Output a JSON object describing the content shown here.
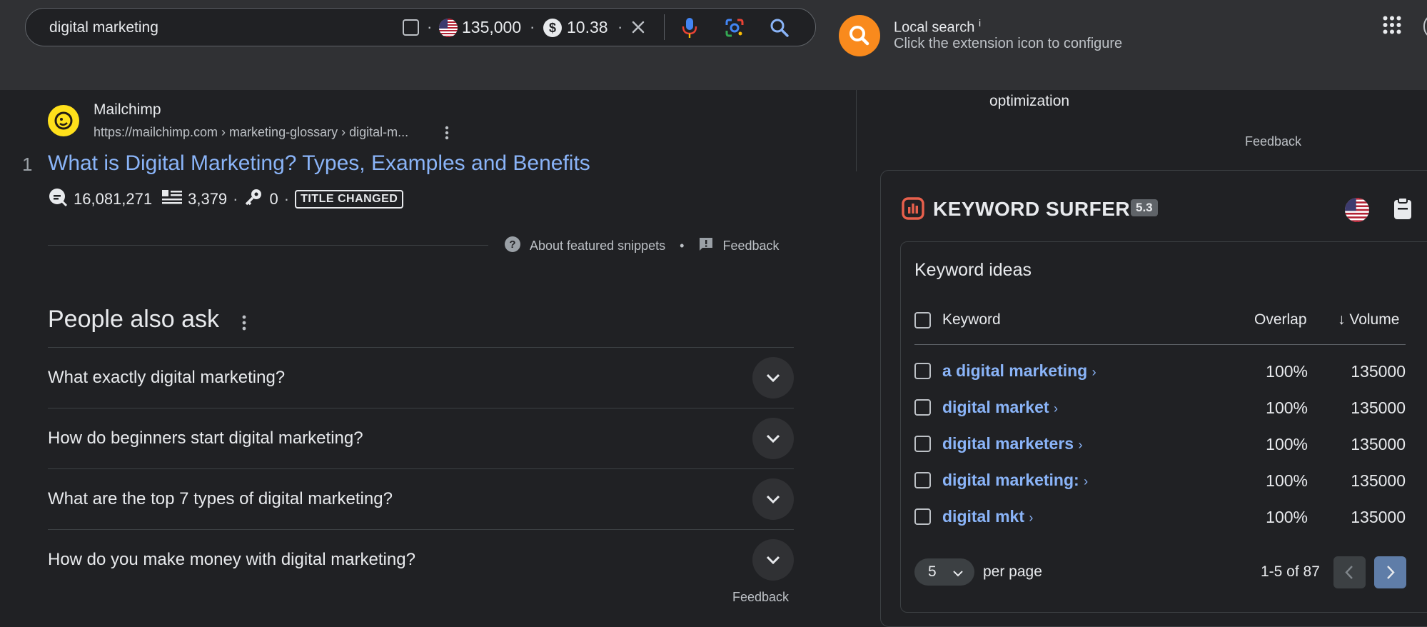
{
  "search": {
    "query": "digital marketing",
    "volume": "135,000",
    "cpc": "10.38"
  },
  "extension": {
    "title": "Local search",
    "info": "i",
    "subtitle": "Click the extension icon to configure"
  },
  "result": {
    "site_name": "Mailchimp",
    "url": "https://mailchimp.com › marketing-glossary › digital-m...",
    "rank": "1",
    "title": "What is Digital Marketing? Types, Examples and Benefits",
    "traffic": "16,081,271",
    "words": "3,379",
    "keywords": "0",
    "badge": "TITLE CHANGED"
  },
  "snippet_footer": {
    "about": "About featured snippets",
    "separator": "•",
    "feedback": "Feedback"
  },
  "paa": {
    "heading": "People also ask",
    "questions": [
      "What exactly digital marketing?",
      "How do beginners start digital marketing?",
      "What are the top 7 types of digital marketing?",
      "How do you make money with digital marketing?"
    ],
    "feedback_partial": "Feedback"
  },
  "right_top": {
    "optimization": "optimization",
    "feedback": "Feedback"
  },
  "surfer": {
    "title": "KEYWORD SURFER",
    "version": "5.3",
    "ideas_title": "Keyword ideas",
    "col_keyword": "Keyword",
    "col_overlap": "Overlap",
    "col_volume": "Volume",
    "sort_arrow": "↓",
    "rows": [
      {
        "keyword": "a digital marketing",
        "overlap": "100%",
        "volume": "135000"
      },
      {
        "keyword": "digital market",
        "overlap": "100%",
        "volume": "135000"
      },
      {
        "keyword": "digital marketers",
        "overlap": "100%",
        "volume": "135000"
      },
      {
        "keyword": "digital marketing:",
        "overlap": "100%",
        "volume": "135000"
      },
      {
        "keyword": "digital mkt",
        "overlap": "100%",
        "volume": "135000"
      }
    ],
    "per_page_value": "5",
    "per_page_label": "per page",
    "range": "1-5 of 87"
  },
  "colors": {
    "background": "#202124",
    "topbar": "#303134",
    "link": "#8ab4f8",
    "extension_orange": "#f98a1d",
    "surfer_red": "#e8604c"
  }
}
